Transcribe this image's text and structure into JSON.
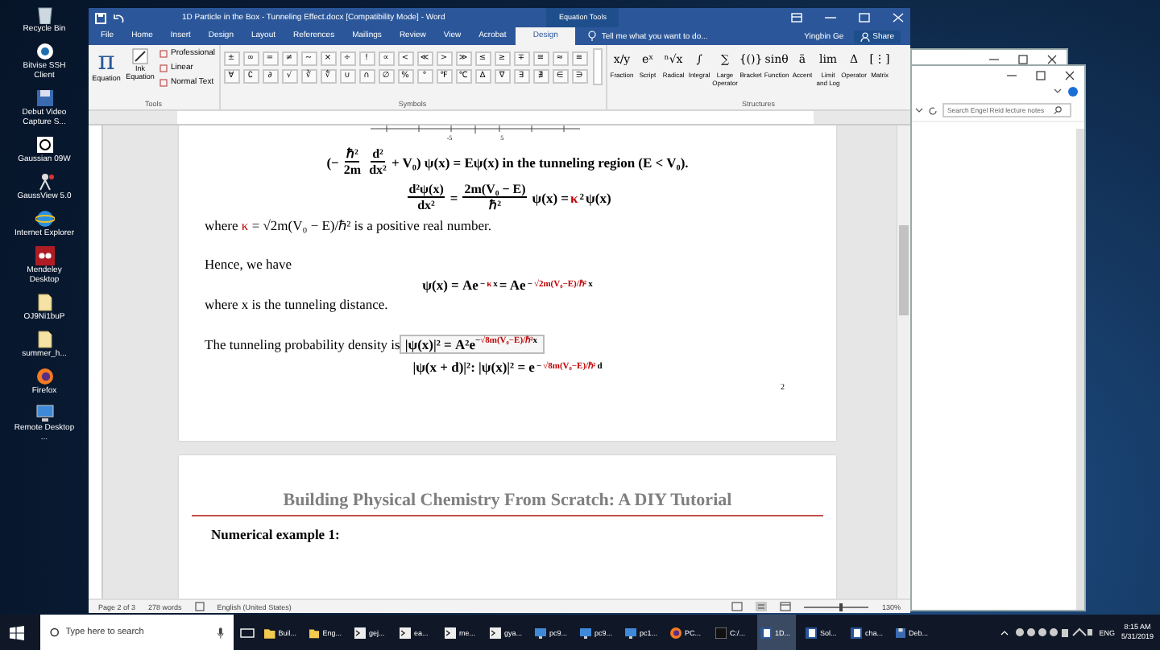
{
  "desktop_icons": [
    {
      "label": "Recycle Bin",
      "kind": "recycle"
    },
    {
      "label": "Bitvise SSH Client",
      "kind": "ssh"
    },
    {
      "label": "Debut Video Capture S...",
      "kind": "video"
    },
    {
      "label": "Gaussian 09W",
      "kind": "gaussian"
    },
    {
      "label": "GaussView 5.0",
      "kind": "gaussview"
    },
    {
      "label": "Internet Explorer",
      "kind": "ie"
    },
    {
      "label": "Mendeley Desktop",
      "kind": "mendeley"
    },
    {
      "label": "OJ9Ni1buP",
      "kind": "file"
    },
    {
      "label": "summer_h...",
      "kind": "file"
    },
    {
      "label": "Firefox",
      "kind": "firefox"
    },
    {
      "label": "Remote Desktop ...",
      "kind": "remote"
    }
  ],
  "word": {
    "title": "1D Particle in the Box - Tunneling Effect.docx [Compatibility Mode] - Word",
    "contextual_tab": "Equation Tools",
    "tabs": [
      {
        "label": "File",
        "selected": false
      },
      {
        "label": "Home",
        "selected": false
      },
      {
        "label": "Insert",
        "selected": false
      },
      {
        "label": "Design",
        "selected": false
      },
      {
        "label": "Layout",
        "selected": false
      },
      {
        "label": "References",
        "selected": false
      },
      {
        "label": "Mailings",
        "selected": false
      },
      {
        "label": "Review",
        "selected": false
      },
      {
        "label": "View",
        "selected": false
      },
      {
        "label": "Acrobat",
        "selected": false
      },
      {
        "label": "Design",
        "selected": true
      }
    ],
    "tell_me": "Tell me what you want to do...",
    "user": "Yingbin Ge",
    "share": "Share",
    "ribbon": {
      "tools": {
        "equation_glyph": "π",
        "equation": "Equation",
        "ink_equation": "Ink Equation",
        "options": [
          "Professional",
          "Linear",
          "Normal Text"
        ],
        "label": "Tools"
      },
      "symbols": {
        "items": [
          "±",
          "∞",
          "=",
          "≠",
          "~",
          "×",
          "÷",
          "!",
          "∝",
          "<",
          "≪",
          ">",
          "≫",
          "≤",
          "≥",
          "∓",
          "≅",
          "≈",
          "≡",
          "∀",
          "∁",
          "∂",
          "√",
          "∛",
          "∜",
          "∪",
          "∩",
          "∅",
          "%",
          "°",
          "℉",
          "℃",
          "∆",
          "∇",
          "∃",
          "∄",
          "∈",
          "∋"
        ],
        "label": "Symbols"
      },
      "structures": {
        "items": [
          {
            "glyph": "x/y",
            "label": "Fraction"
          },
          {
            "glyph": "eˣ",
            "label": "Script"
          },
          {
            "glyph": "ⁿ√x",
            "label": "Radical"
          },
          {
            "glyph": "∫",
            "label": "Integral"
          },
          {
            "glyph": "∑",
            "label": "Large Operator"
          },
          {
            "glyph": "{()}",
            "label": "Bracket"
          },
          {
            "glyph": "sinθ",
            "label": "Function"
          },
          {
            "glyph": "ä",
            "label": "Accent"
          },
          {
            "glyph": "lim",
            "label": "Limit and Log"
          },
          {
            "glyph": "Δ",
            "label": "Operator"
          },
          {
            "glyph": "[⋮]",
            "label": "Matrix"
          }
        ],
        "label": "Structures"
      }
    },
    "document": {
      "axis_ticks": [
        "-5",
        "5"
      ],
      "blocks": [
        {
          "kind": "display",
          "segments": [
            {
              "kind": "text",
              "t": "(−"
            },
            {
              "kind": "frac",
              "num": "ℏ²",
              "den": "2m"
            },
            {
              "kind": "frac",
              "num": "d²",
              "den": "dx²"
            },
            {
              "kind": "text",
              "t": "+ V₀) ψ(x) = Eψ(x) in the tunneling region (E < V₀)."
            }
          ]
        },
        {
          "kind": "display",
          "segments": [
            {
              "kind": "frac",
              "num": "d²ψ(x)",
              "den": "dx²"
            },
            {
              "kind": "text",
              "t": " = "
            },
            {
              "kind": "frac",
              "num": "2m(V₀ − E)",
              "den": "ℏ²"
            },
            {
              "kind": "text",
              "t": "ψ(x) = "
            },
            {
              "kind": "red",
              "t": "κ"
            },
            {
              "kind": "sup",
              "t": "2"
            },
            {
              "kind": "text",
              "t": "ψ(x)"
            }
          ]
        },
        {
          "kind": "para",
          "segments": [
            {
              "kind": "text",
              "t": "where "
            },
            {
              "kind": "red",
              "t": "κ"
            },
            {
              "kind": "text",
              "t": " = √2m(V₀ − E)/ℏ² is a positive real number."
            }
          ]
        },
        {
          "kind": "gap"
        },
        {
          "kind": "para",
          "segments": [
            {
              "kind": "text",
              "t": "Hence, we have"
            }
          ]
        },
        {
          "kind": "display",
          "segments": [
            {
              "kind": "text",
              "t": "ψ(x) = Ae"
            },
            {
              "kind": "sup",
              "t": "−"
            },
            {
              "kind": "redsup",
              "t": "κ"
            },
            {
              "kind": "sup",
              "t": "x"
            },
            {
              "kind": "text",
              "t": " = Ae"
            },
            {
              "kind": "sup",
              "t": "−"
            },
            {
              "kind": "redsup",
              "t": "√2m(V₀−E)/ℏ²"
            },
            {
              "kind": "sup",
              "t": "x"
            }
          ]
        },
        {
          "kind": "para",
          "segments": [
            {
              "kind": "text",
              "t": "where x is the tunneling distance."
            }
          ]
        },
        {
          "kind": "gap"
        },
        {
          "kind": "para",
          "segments": [
            {
              "kind": "text",
              "t": "The tunneling probability density is "
            },
            {
              "kind": "box",
              "parts": [
                {
                  "kind": "text",
                  "t": "|ψ(x)|² = A²e"
                },
                {
                  "kind": "sup",
                  "t": "−"
                },
                {
                  "kind": "redsup",
                  "t": "√8m(V₀−E)/ℏ²"
                },
                {
                  "kind": "sup",
                  "t": "x"
                }
              ]
            }
          ]
        },
        {
          "kind": "display",
          "segments": [
            {
              "kind": "text",
              "t": "|ψ(x + d)|²: |ψ(x)|² = e"
            },
            {
              "kind": "sup",
              "t": "−"
            },
            {
              "kind": "redsup",
              "t": "√8m(V₀−E)/ℏ²"
            },
            {
              "kind": "sup",
              "t": "d"
            }
          ]
        }
      ],
      "page_number": "2",
      "heading": "Building Physical Chemistry From Scratch: A DIY Tutorial",
      "subheading": "Numerical example 1:"
    },
    "status_bar": {
      "page": "Page 2 of 3",
      "words": "278 words",
      "language": "English (United States)",
      "zoom": "130%",
      "level": 0.55
    }
  },
  "explorer": {
    "search_placeholder": "Search Engel Reid lecture notes"
  },
  "taskbar": {
    "search_placeholder": "Type here to search",
    "items": [
      {
        "label": "Buil...",
        "kind": "folder",
        "active": false
      },
      {
        "label": "Eng...",
        "kind": "folder",
        "active": false
      },
      {
        "label": "gej...",
        "kind": "terminal",
        "active": false
      },
      {
        "label": "ea...",
        "kind": "terminal",
        "active": false
      },
      {
        "label": "me...",
        "kind": "terminal",
        "active": false
      },
      {
        "label": "gya...",
        "kind": "terminal",
        "active": false
      },
      {
        "label": "pc9...",
        "kind": "remote",
        "active": false
      },
      {
        "label": "pc9...",
        "kind": "remote",
        "active": false
      },
      {
        "label": "pc1...",
        "kind": "remote",
        "active": false
      },
      {
        "label": "PC...",
        "kind": "firefox",
        "active": false
      },
      {
        "label": "C:/...",
        "kind": "console",
        "active": false
      },
      {
        "label": "1D...",
        "kind": "word",
        "active": true
      },
      {
        "label": "Sol...",
        "kind": "word",
        "active": false
      },
      {
        "label": "cha...",
        "kind": "word",
        "active": false
      },
      {
        "label": "Deb...",
        "kind": "video",
        "active": false
      }
    ],
    "language": "ENG",
    "time": "8:15 AM",
    "date": "5/31/2019"
  }
}
